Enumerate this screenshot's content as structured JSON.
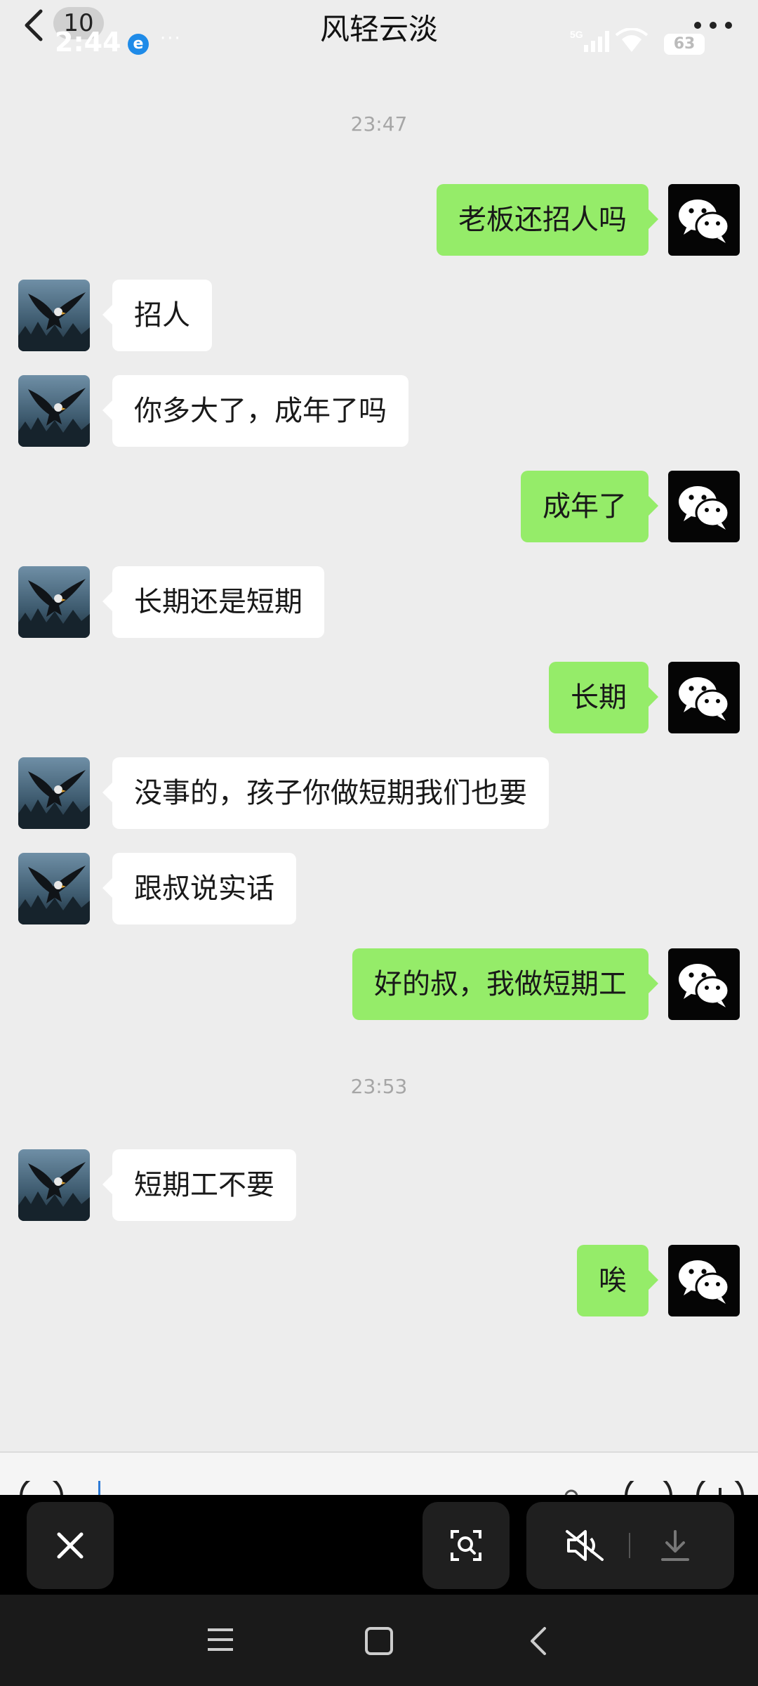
{
  "header": {
    "title": "风轻云淡",
    "unread_count": "10",
    "back_icon": "chevron-left-icon",
    "more_icon": "more-horizontal-icon"
  },
  "status_bar": {
    "time": "2:44",
    "browser_icon_letter": "e",
    "dots": "···",
    "network": "5G",
    "battery": "63"
  },
  "timestamps": [
    "23:47",
    "23:53"
  ],
  "messages": [
    {
      "side": "out",
      "text": "老板还招人吗"
    },
    {
      "side": "in",
      "text": "招人"
    },
    {
      "side": "in",
      "text": "你多大了，成年了吗"
    },
    {
      "side": "out",
      "text": "成年了"
    },
    {
      "side": "in",
      "text": "长期还是短期"
    },
    {
      "side": "out",
      "text": "长期"
    },
    {
      "side": "in",
      "text": "没事的，孩子你做短期我们也要"
    },
    {
      "side": "in",
      "text": "跟叔说实话"
    },
    {
      "side": "out",
      "text": "好的叔，我做短期工"
    },
    {
      "side": "in",
      "text": "短期工不要"
    },
    {
      "side": "out",
      "text": "唉"
    }
  ],
  "colors": {
    "background": "#ededed",
    "bubble_out": "#95ec69",
    "bubble_in": "#ffffff",
    "overlay": "#000000"
  },
  "overlay_controls": {
    "close_icon": "close-icon",
    "scan_icon": "image-search-icon",
    "mute_icon": "volume-mute-icon",
    "download_icon": "download-icon"
  },
  "navigation": {
    "menu_icon": "menu-icon",
    "home_icon": "home-square-icon",
    "back_icon": "nav-back-icon"
  }
}
